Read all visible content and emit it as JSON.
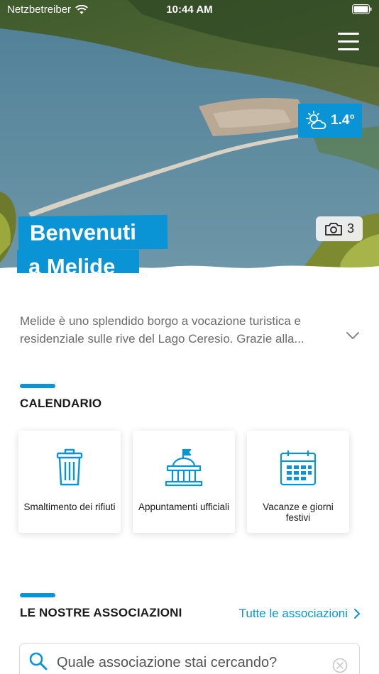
{
  "status_bar": {
    "carrier": "Netzbetreiber",
    "time": "10:44 AM"
  },
  "hero": {
    "title_line1": "Benvenuti",
    "title_line2": "a Melide",
    "weather": {
      "icon": "sun-cloud-icon",
      "temperature": "1.4°"
    },
    "photos": {
      "icon": "camera-icon",
      "count": "3"
    }
  },
  "intro": {
    "text": "Melide è uno splendido borgo a vocazione turistica e residenziale sulle rive del Lago Ceresio. Grazie alla..."
  },
  "calendar": {
    "title": "CALENDARIO",
    "cards": [
      {
        "label": "Smaltimento dei rifiuti",
        "icon": "trash-bin-icon"
      },
      {
        "label": "Appuntamenti ufficiali",
        "icon": "town-hall-icon"
      },
      {
        "label": "Vacanze e giorni festivi",
        "icon": "calendar-icon"
      }
    ]
  },
  "associations": {
    "title": "LE NOSTRE ASSOCIAZIONI",
    "all_link": "Tutte le associazioni",
    "search_placeholder": "Quale associazione stai cercando?"
  },
  "colors": {
    "accent": "#0a94d6",
    "text": "#1a1a1a",
    "muted": "#6b6b6b"
  }
}
